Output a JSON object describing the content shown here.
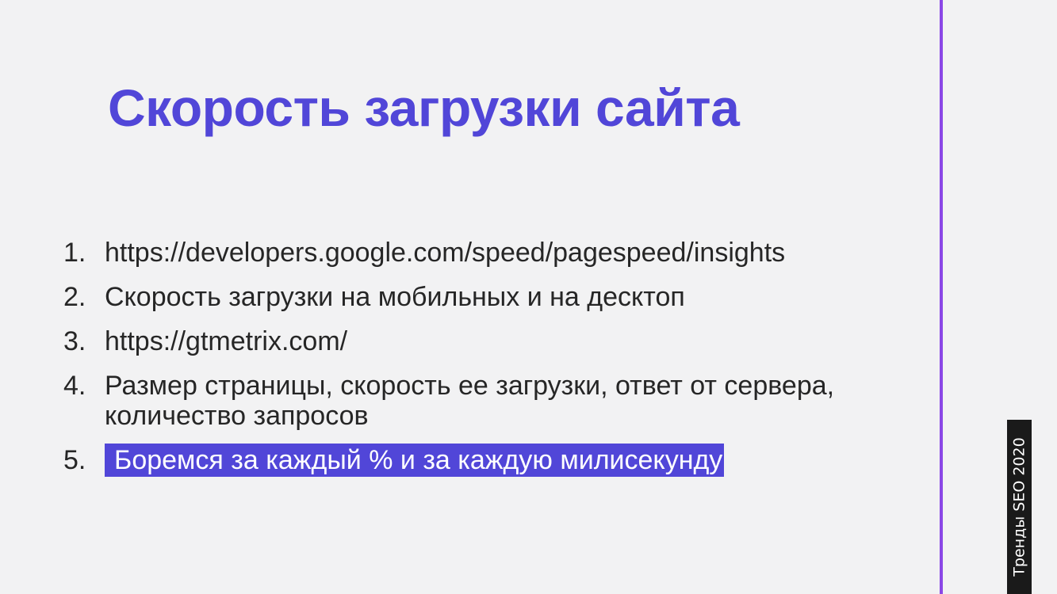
{
  "slide": {
    "title": "Скорость загрузки сайта",
    "items": [
      {
        "number": "1.",
        "text": "https://developers.google.com/speed/pagespeed/insights"
      },
      {
        "number": "2.",
        "text": "Скорость загрузки на мобильных и на десктоп"
      },
      {
        "number": "3.",
        "text": "https://gtmetrix.com/"
      },
      {
        "number": "4.",
        "text": "Размер страницы, скорость ее загрузки, ответ от сервера, количество запросов"
      },
      {
        "number": "5.",
        "text": "Боремся за каждый % и за каждую милисекунду"
      }
    ],
    "side_label": "Тренды SEO 2020"
  },
  "colors": {
    "background": "#f2f2f3",
    "title": "#5146d8",
    "accent_line": "#8b47e6",
    "highlight": "#5146d8",
    "side_label_bg": "#1a1a1a"
  }
}
